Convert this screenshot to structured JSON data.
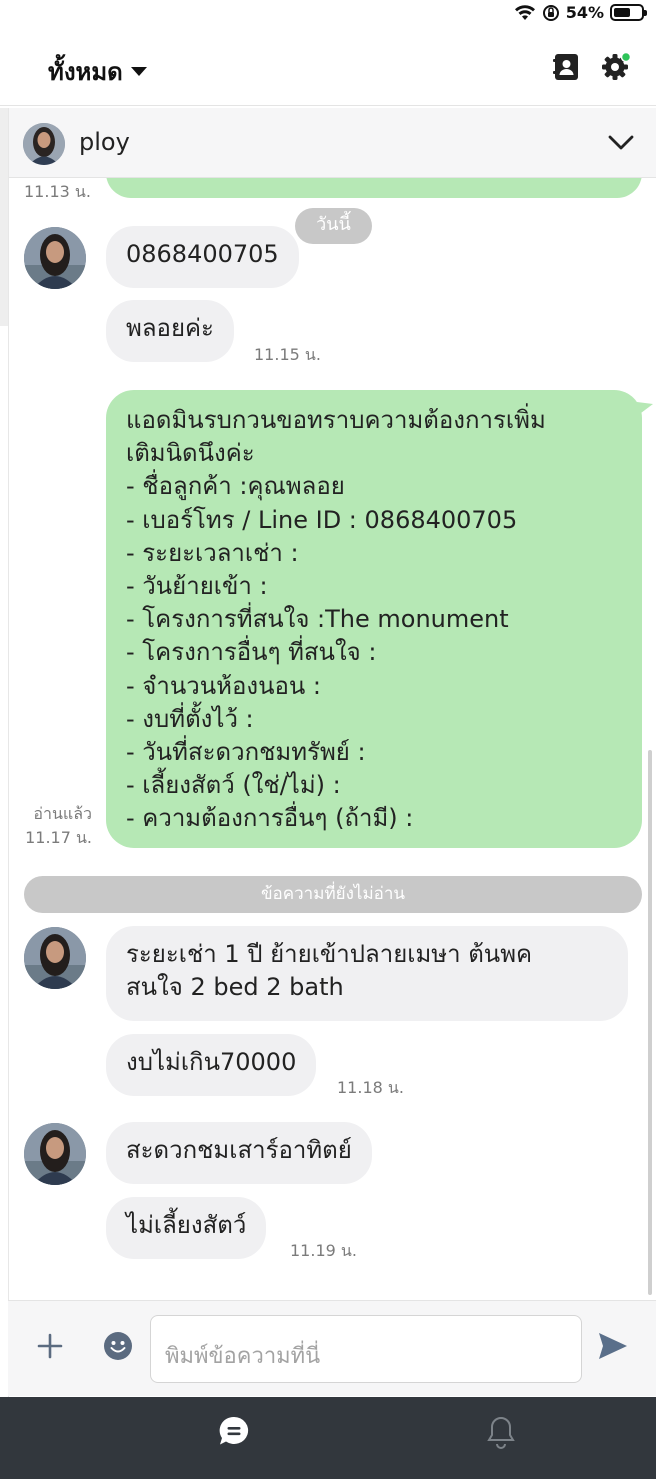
{
  "status": {
    "battery": "54%",
    "battery_level": 0.54
  },
  "header": {
    "filter_label": "ทั้งหมด",
    "contacts_icon": "contacts-icon",
    "settings_icon": "settings-icon"
  },
  "room": {
    "name": "ploy"
  },
  "messages": {
    "cut_time": "11.13 น.",
    "today_chip": "วันนี้",
    "m1": "0868400705",
    "m2": "พลอยค่ะ",
    "t1": "11.15 น.",
    "out_lines": [
      "แอดมินรบกวนขอทราบความต้องการเพิ่ม",
      "เติมนิดนึงค่ะ",
      "- ชื่อลูกค้า :คุณพลอย",
      "- เบอร์โทร / Line ID : 0868400705",
      "- ระยะเวลาเช่า :",
      "- วันย้ายเข้า :",
      "- โครงการที่สนใจ :The monument",
      "- โครงการอื่นๆ ที่สนใจ :",
      "- จำนวนห้องนอน :",
      "- งบที่ตั้งไว้ :",
      "- วันที่สะดวกชมทรัพย์ :",
      "- เลี้ยงสัตว์ (ใช่/ไม่) :",
      "- ความต้องการอื่นๆ (ถ้ามี) :"
    ],
    "read_label": "อ่านแล้ว",
    "t2": "11.17 น.",
    "unread_divider": "ข้อความที่ยังไม่อ่าน",
    "m3_line1": "ระยะเช่า 1 ปี ย้ายเข้าปลายเมษา ต้นพค",
    "m3_line2": "สนใจ 2 bed 2 bath",
    "m4": "งบไม่เกิน70000",
    "t3": "11.18 น.",
    "m5": "สะดวกชมเสาร์อาทิตย์",
    "m6": "ไม่เลี้ยงสัตว์",
    "t4": "11.19 น."
  },
  "composer": {
    "placeholder": "พิมพ์ข้อความที่นี่"
  },
  "colors": {
    "outgoing": "#b6e8b5",
    "incoming": "#f0f0f2",
    "nav": "#32373d",
    "send": "#5a6f8a"
  }
}
